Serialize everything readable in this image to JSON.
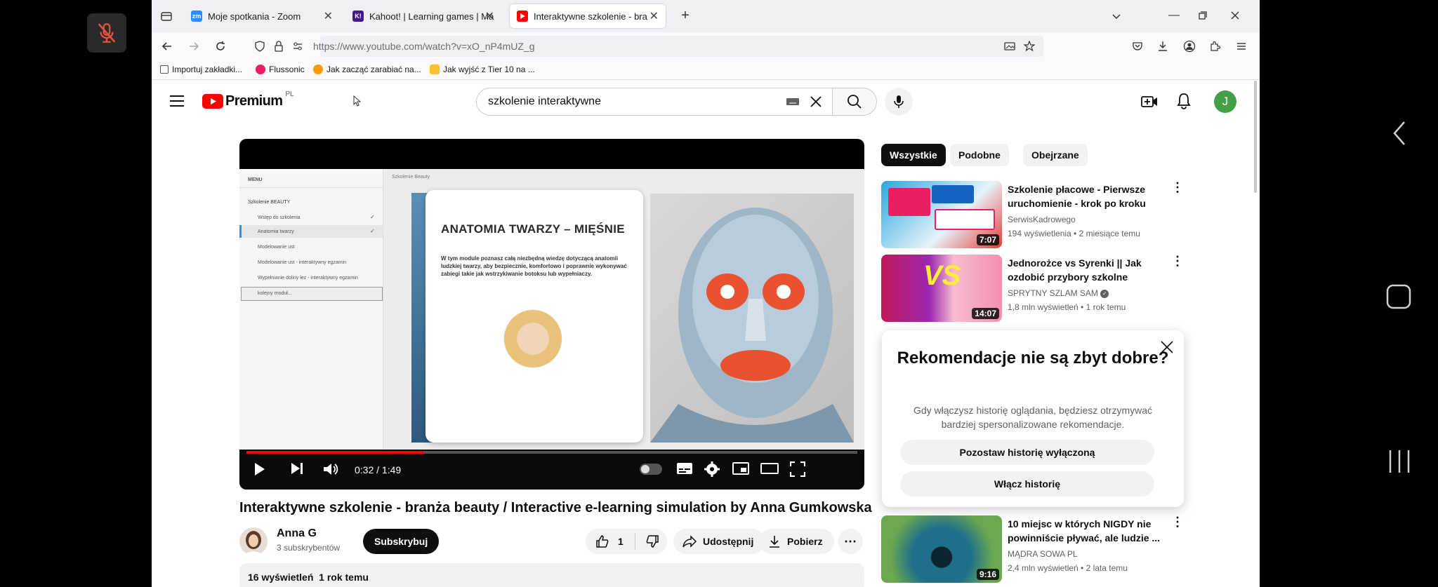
{
  "browser": {
    "tabs": [
      {
        "label": "Moje spotkania - Zoom",
        "favicon": "zoom-icon",
        "color": "#2d8cff",
        "fav_text": "zm"
      },
      {
        "label": "Kahoot! | Learning games | Mak",
        "favicon": "kahoot-icon",
        "color": "#46178f",
        "fav_text": "K!"
      },
      {
        "label": "Interaktywne szkolenie - branż",
        "favicon": "youtube-icon",
        "color": "#ff0000",
        "fav_text": ""
      }
    ],
    "url": "https://www.youtube.com/watch?v=xO_nP4mUZ_g",
    "bookmarks": [
      {
        "label": "Importuj zakładki...",
        "color": "#555555"
      },
      {
        "label": "Flussonic",
        "color": "#e91e63"
      },
      {
        "label": "Jak zacząć zarabiać na...",
        "color": "#ff9800"
      },
      {
        "label": "Jak wyjść z Tier 10 na ...",
        "color": "#fbc02d"
      }
    ]
  },
  "youtube": {
    "logo_text": "Premium",
    "logo_region": "PL",
    "search_value": "szkolenie interaktywne",
    "avatar_letter": "J",
    "accent_color": "#ff0000"
  },
  "player": {
    "progress": 0.29,
    "time": "0:32 / 1:49",
    "slide": {
      "menu_header": "MENU",
      "breadcrumb": "Szkolenie Beauty",
      "menu_section": "Szkolenie BEAUTY",
      "menu_items": [
        "Wstęp do szkolenia",
        "Anatomia twarzy",
        "Modelowanie ust",
        "Modelowanie ust - interaktywny egzamin",
        "Wypełnianie doliny łez - interaktywny egzamin",
        "kolejny moduł..."
      ],
      "title": "ANATOMIA TWARZY – MIĘŚNIE",
      "description": "W tym module poznasz całą niezbędną wiedzę dotyczącą anatomii ludzkiej twarzy, aby bezpiecznie, komfortowo i poprawnie wykonywać zabiegi takie jak wstrzykiwanie botoksu lub wypełniaczy."
    }
  },
  "video": {
    "title": "Interaktywne szkolenie - branża beauty / Interactive e-learning simulation by Anna Gumkowska",
    "channel": "Anna G",
    "subscribers": "3 subskrybentów",
    "subscribe_label": "Subskrybuj",
    "likes": "1",
    "share_label": "Udostępnij",
    "download_label": "Pobierz",
    "views_line": "16 wyświetleń  1 rok temu"
  },
  "sidebar": {
    "chips": [
      "Wszystkie",
      "Podobne",
      "Obejrzane"
    ],
    "recommendations": [
      {
        "title": "Szkolenie płacowe - Pierwsze uruchomienie - krok po kroku",
        "channel": "SerwisKadrowego",
        "meta": "194 wyświetlenia • 2 miesiące temu",
        "duration": "7:07"
      },
      {
        "title": "Jednorożce vs Syrenki || Jak ozdobić przybory szkolne",
        "channel": "SPRYTNY SZLAM SAM",
        "meta": "1,8 mln wyświetleń • 1 rok temu",
        "duration": "14:07"
      },
      {
        "title": "10 miejsc w których NIGDY nie powinniście pływać, ale ludzie ...",
        "channel": "MĄDRA SOWA PL",
        "meta": "2,4 mln wyświetleń • 2 lata temu",
        "duration": "9:16"
      }
    ],
    "popup": {
      "title": "Rekomendacje nie są zbyt dobre?",
      "body": "Gdy włączysz historię oglądania, będziesz otrzymywać bardziej spersonalizowane rekomendacje.",
      "button1": "Pozostaw historię wyłączoną",
      "button2": "Włącz historię"
    }
  }
}
